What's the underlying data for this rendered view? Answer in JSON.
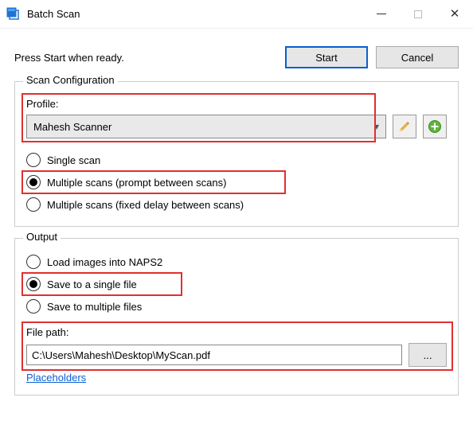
{
  "window": {
    "title": "Batch Scan"
  },
  "top": {
    "prompt": "Press Start when ready.",
    "start": "Start",
    "cancel": "Cancel"
  },
  "scan_config": {
    "legend": "Scan Configuration",
    "profile_label": "Profile:",
    "profile_value": "Mahesh Scanner",
    "edit_icon": "pencil-icon",
    "add_icon": "add-icon",
    "radios": {
      "single": {
        "label": "Single scan",
        "checked": false
      },
      "multi_prompt": {
        "label": "Multiple scans (prompt between scans)",
        "checked": true
      },
      "multi_delay": {
        "label": "Multiple scans (fixed delay between scans)",
        "checked": false
      }
    }
  },
  "output": {
    "legend": "Output",
    "radios": {
      "load_naps2": {
        "label": "Load images into NAPS2",
        "checked": false
      },
      "save_single": {
        "label": "Save to a single file",
        "checked": true
      },
      "save_multiple": {
        "label": "Save to multiple files",
        "checked": false
      }
    },
    "filepath_label": "File path:",
    "filepath_value": "C:\\Users\\Mahesh\\Desktop\\MyScan.pdf",
    "browse": "...",
    "placeholders": "Placeholders"
  }
}
